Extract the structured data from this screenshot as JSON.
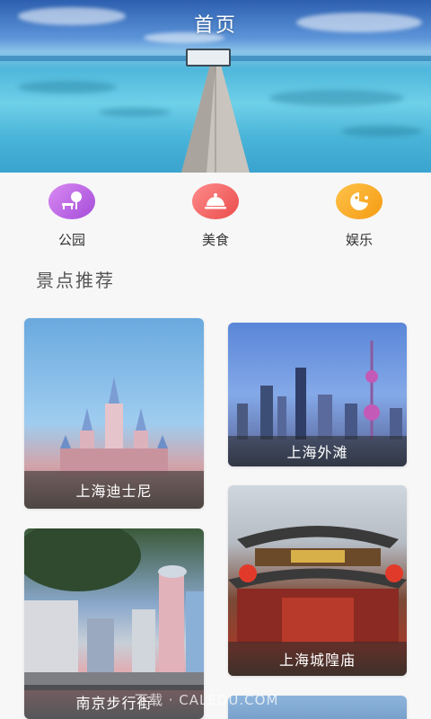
{
  "header": {
    "title": "首页"
  },
  "categories": [
    {
      "label": "公园",
      "icon": "park-bench-icon",
      "color": "#b65fe3"
    },
    {
      "label": "美食",
      "icon": "cloche-icon",
      "color": "#f05a5a"
    },
    {
      "label": "娱乐",
      "icon": "game-face-icon",
      "color": "#f7a92a"
    }
  ],
  "section": {
    "title": "景点推荐"
  },
  "attractions": [
    {
      "name": "上海迪士尼"
    },
    {
      "name": "上海外滩"
    },
    {
      "name": "上海城隍庙"
    },
    {
      "name": "南京步行街"
    }
  ],
  "watermark": "下载 · CALEDU.COM"
}
